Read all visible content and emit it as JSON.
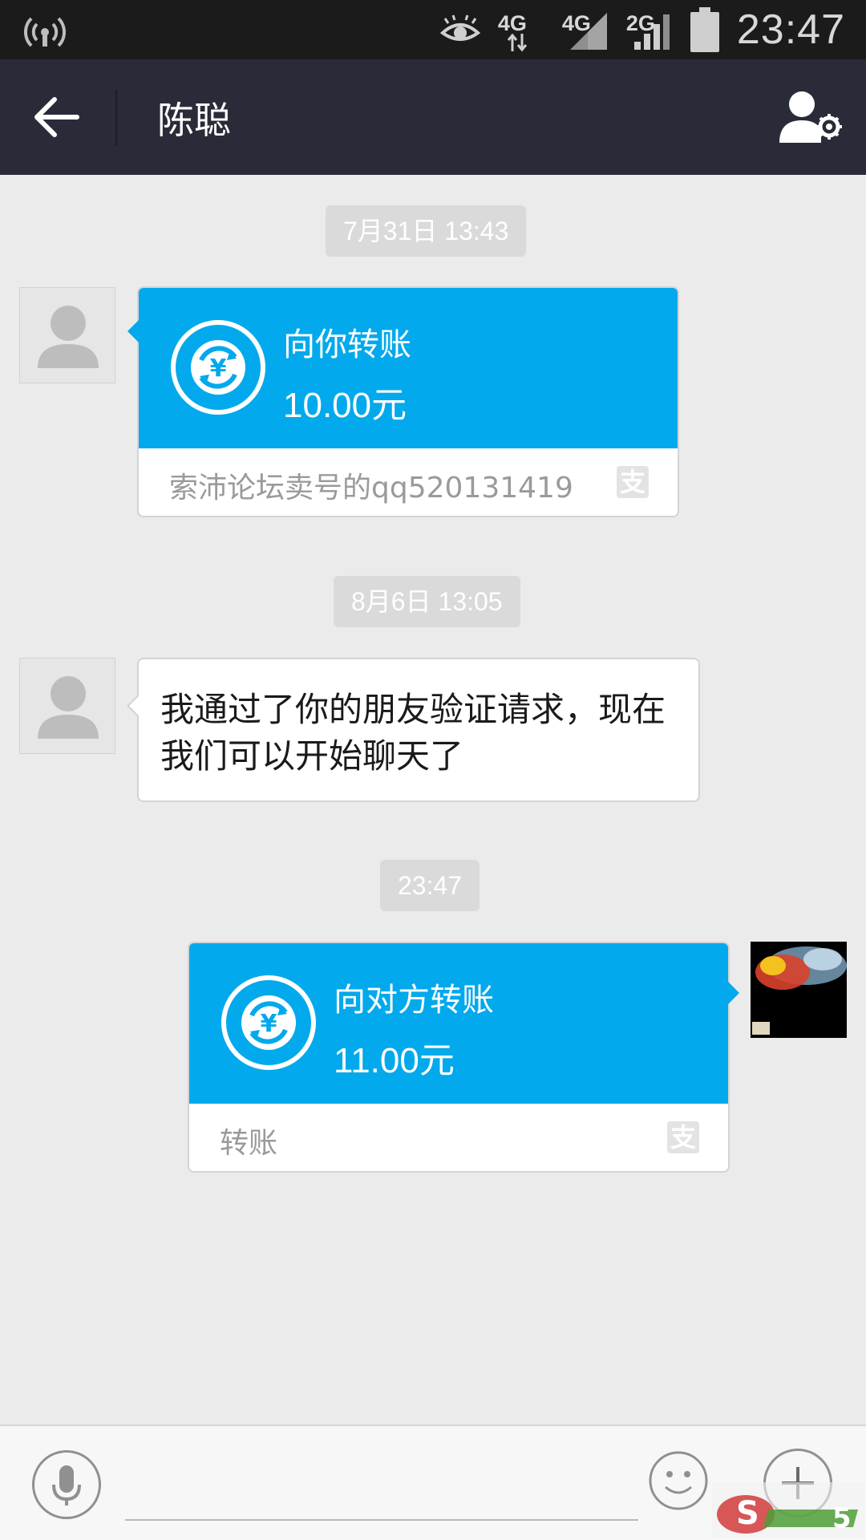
{
  "status_bar": {
    "time": "23:47",
    "network_1": "4G",
    "network_2": "4G",
    "network_3": "2G"
  },
  "header": {
    "title": "陈聪"
  },
  "messages": [
    {
      "timestamp": "7月31日 13:43",
      "type": "transfer",
      "direction": "incoming",
      "title": "向你转账",
      "amount": "10.00元",
      "note": "索沛论坛卖号的qq520131419"
    },
    {
      "timestamp": "8月6日 13:05",
      "type": "text",
      "direction": "incoming",
      "text": "我通过了你的朋友验证请求，现在我们可以开始聊天了"
    },
    {
      "timestamp": "23:47",
      "type": "transfer",
      "direction": "outgoing",
      "title": "向对方转账",
      "amount": "11.00元",
      "note": "转账"
    }
  ],
  "input_bar": {
    "placeholder": ""
  },
  "icons": {
    "transfer_badge": "支",
    "alipay_icon": "alipay-icon"
  },
  "colors": {
    "accent": "#02a9ec",
    "header_bg": "#2a2b38",
    "chat_bg": "#ebebeb"
  }
}
